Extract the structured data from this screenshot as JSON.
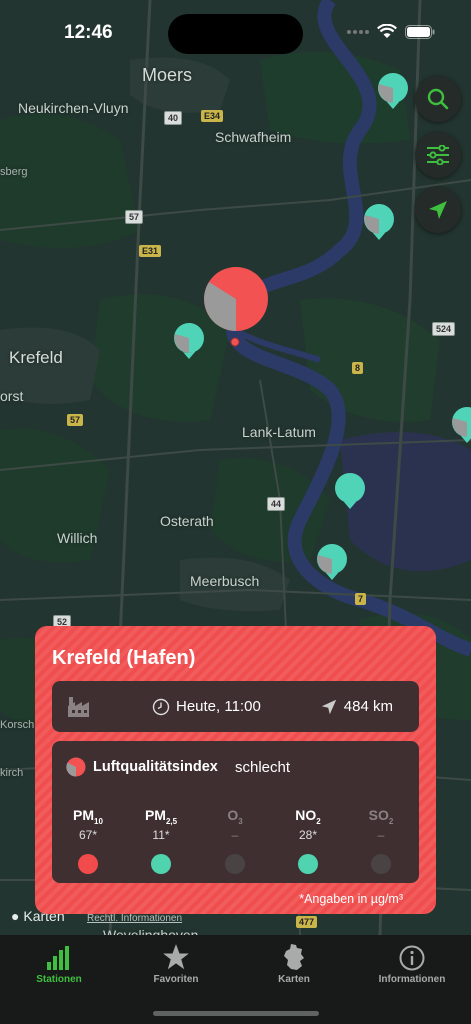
{
  "status_bar": {
    "time": "12:46"
  },
  "map": {
    "places": {
      "moers": "Moers",
      "neukirchen": "Neukirchen-Vluyn",
      "schwafheim": "Schwafheim",
      "sberg": "sberg",
      "krefeld": "Krefeld",
      "orst": "orst",
      "lank": "Lank-Latum",
      "osterath": "Osterath",
      "willich": "Willich",
      "meerbusch": "Meerbusch",
      "korsch": "Korsch",
      "kirch": "kirch",
      "wevelinghoven": "Wevelinghoven"
    },
    "roads": {
      "r40": "40",
      "e34": "E34",
      "r57a": "57",
      "e31": "E31",
      "r524": "524",
      "r8": "8",
      "r57b": "57",
      "r44": "44",
      "r7": "7",
      "r52": "52",
      "r477": "477"
    },
    "attribution": "Karten",
    "legal": "Rechtl. Informationen"
  },
  "station": {
    "name": "Krefeld (Hafen)",
    "time": "Heute, 11:00",
    "distance": "484 km",
    "aqi_label": "Luftqualitätsindex",
    "aqi_value": "schlecht",
    "pollutants": [
      {
        "name": "PM",
        "sub": "10",
        "value": "67*",
        "color": "#f24b4b"
      },
      {
        "name": "PM",
        "sub": "2,5",
        "value": "11*",
        "color": "#50d4b0"
      },
      {
        "name": "O",
        "sub": "3",
        "value": "–",
        "color": "#4a4344"
      },
      {
        "name": "NO",
        "sub": "2",
        "value": "28*",
        "color": "#50d4b0"
      },
      {
        "name": "SO",
        "sub": "2",
        "value": "–",
        "color": "#4a4344"
      }
    ],
    "footnote": "*Angaben in µg/m³"
  },
  "tabs": [
    {
      "label": "Stationen",
      "icon": "bar-chart-icon",
      "active": true
    },
    {
      "label": "Favoriten",
      "icon": "star-icon",
      "active": false
    },
    {
      "label": "Karten",
      "icon": "germany-map-icon",
      "active": false
    },
    {
      "label": "Informationen",
      "icon": "info-icon",
      "active": false
    }
  ],
  "colors": {
    "accent": "#3fbf3f",
    "bad": "#f24b4b",
    "good": "#50d4b0",
    "card": "#f04e4e"
  }
}
